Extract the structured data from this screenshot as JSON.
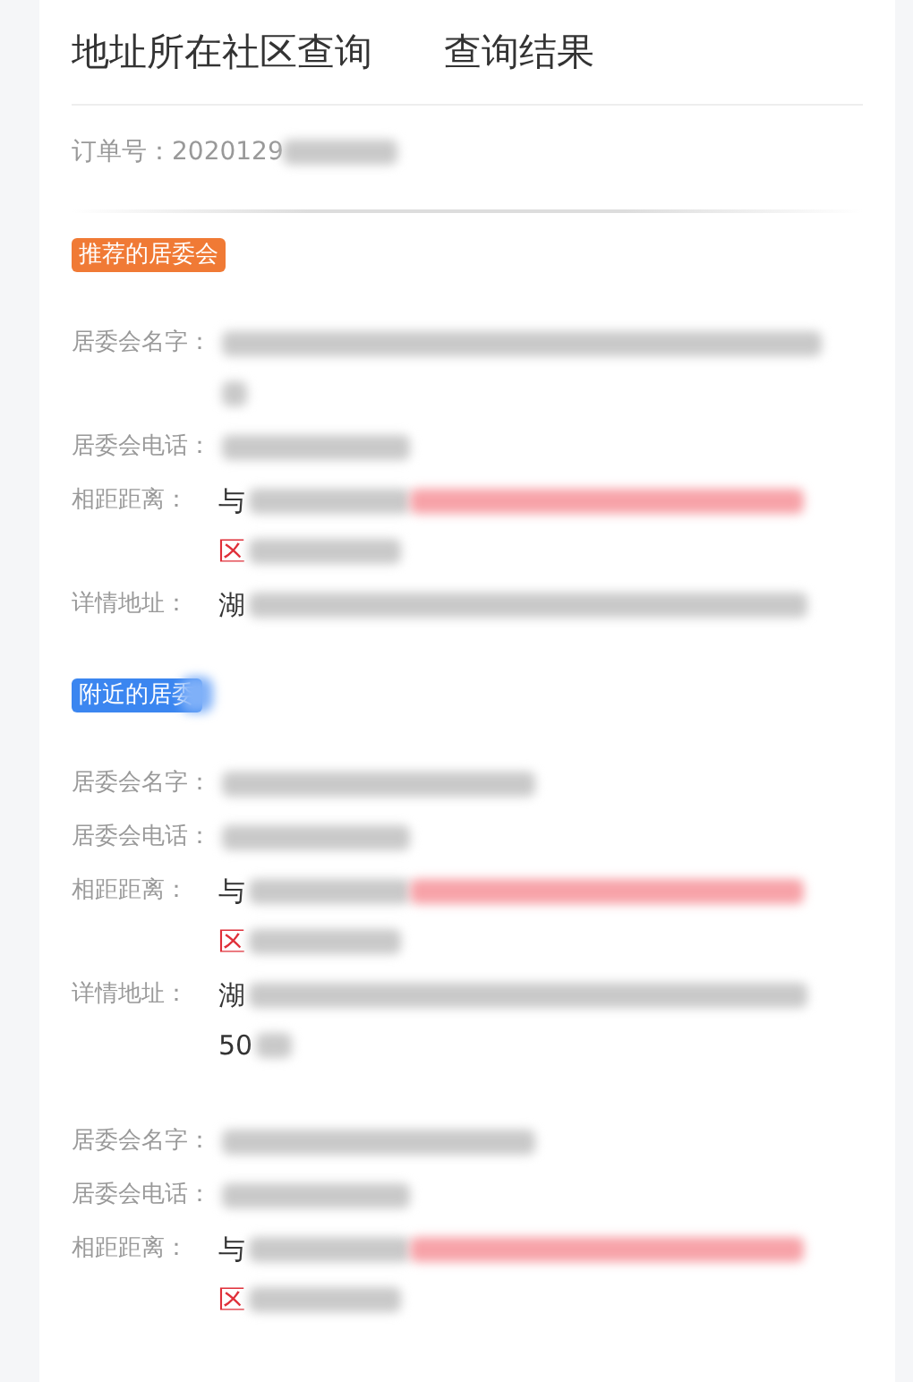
{
  "header": {
    "title": "地址所在社区查询",
    "subtitle": "查询结果"
  },
  "order": {
    "label": "订单号：",
    "value": "2020129"
  },
  "sections": [
    {
      "tag": {
        "kind": "recommended",
        "text": "推荐的居委会"
      },
      "rows": [
        {
          "kind": "name-wrapped",
          "label": "居委会名字：",
          "lines": []
        },
        {
          "kind": "phone",
          "label": "居委会电话：",
          "lines": []
        },
        {
          "kind": "distance",
          "label": "相距距离：",
          "lines": [
            {
              "text": "与",
              "highlight": false
            },
            {
              "text": "区",
              "highlight": true
            }
          ]
        },
        {
          "kind": "address",
          "label": "详情地址：",
          "lines": [
            {
              "text": "湖",
              "highlight": false
            }
          ]
        }
      ]
    },
    {
      "tag": {
        "kind": "nearby",
        "text": "附近的居委"
      },
      "rows": [
        {
          "kind": "name",
          "label": "居委会名字：",
          "lines": []
        },
        {
          "kind": "phone",
          "label": "居委会电话：",
          "lines": []
        },
        {
          "kind": "distance",
          "label": "相距距离：",
          "lines": [
            {
              "text": "与",
              "highlight": false
            },
            {
              "text": "区",
              "highlight": true
            }
          ]
        },
        {
          "kind": "address",
          "label": "详情地址：",
          "lines": [
            {
              "text": "湖",
              "highlight": false
            },
            {
              "text": "50",
              "highlight": false
            }
          ]
        }
      ]
    },
    {
      "rows": [
        {
          "kind": "name",
          "label": "居委会名字：",
          "lines": []
        },
        {
          "kind": "phone",
          "label": "居委会电话：",
          "lines": []
        },
        {
          "kind": "distance",
          "label": "相距距离：",
          "lines": [
            {
              "text": "与",
              "highlight": false
            },
            {
              "text": "区",
              "highlight": true
            }
          ]
        }
      ]
    }
  ]
}
